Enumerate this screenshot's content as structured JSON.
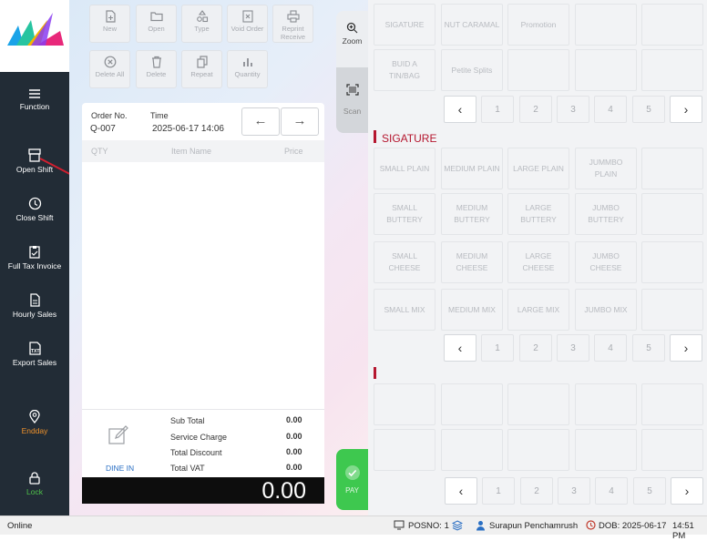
{
  "sidebar": {
    "items": [
      {
        "label": "Function",
        "icon": "menu-icon"
      },
      {
        "label": "Open Shift",
        "icon": "register-icon"
      },
      {
        "label": "Close Shift",
        "icon": "clock-icon"
      },
      {
        "label": "Full Tax Invoice",
        "icon": "clipboard-icon"
      },
      {
        "label": "Hourly Sales",
        "icon": "document-icon"
      },
      {
        "label": "Export Sales",
        "icon": "txt-file-icon"
      },
      {
        "label": "Endday",
        "icon": "location-pin-icon"
      },
      {
        "label": "Lock",
        "icon": "lock-icon"
      }
    ]
  },
  "toolbar": {
    "row1": [
      {
        "label": "New"
      },
      {
        "label": "Open"
      },
      {
        "label": "Type"
      },
      {
        "label": "Void Order"
      },
      {
        "label": "Reprint Receive"
      }
    ],
    "row2": [
      {
        "label": "Delete All"
      },
      {
        "label": "Delete"
      },
      {
        "label": "Repeat"
      },
      {
        "label": "Quantity"
      }
    ]
  },
  "order": {
    "no_label": "Order No.",
    "no": "Q-007",
    "time_label": "Time",
    "time": "2025-06-17 14:06",
    "col_qty": "QTY",
    "col_item": "Item Name",
    "col_price": "Price",
    "order_type": "DINE IN",
    "subtotal_label": "Sub Total",
    "subtotal": "0.00",
    "service_label": "Service Charge",
    "service": "0.00",
    "discount_label": "Total Discount",
    "discount": "0.00",
    "vat_label": "Total VAT",
    "vat": "0.00",
    "grand_total": "0.00"
  },
  "side": {
    "zoom": "Zoom",
    "scan": "Scan",
    "pay": "PAY"
  },
  "categories": [
    [
      "SIGATURE",
      "NUT CARAMAL",
      "Promotion",
      "",
      ""
    ],
    [
      "BUID A TIN/BAG",
      "Petite Splits",
      "",
      "",
      ""
    ]
  ],
  "pager": {
    "prev": "‹",
    "next": "›",
    "pages": [
      "1",
      "2",
      "3",
      "4",
      "5"
    ]
  },
  "section1_title": "SIGATURE",
  "products": [
    [
      "SMALL PLAIN",
      "MEDIUM PLAIN",
      "LARGE PLAIN",
      "JUMMBO PLAIN",
      ""
    ],
    [
      "SMALL BUTTERY",
      "MEDIUM BUTTERY",
      "LARGE BUTTERY",
      "JUMBO BUTTERY",
      ""
    ],
    [
      "SMALL CHEESE",
      "MEDIUM CHEESE",
      "LARGE CHEESE",
      "JUMBO CHEESE",
      ""
    ],
    [
      "SMALL MIX",
      "MEDIUM MIX",
      "LARGE MIX",
      "JUMBO MIX",
      ""
    ]
  ],
  "annotation": "1",
  "status": {
    "online": "Online",
    "posno": "POSNO: 1",
    "user": "Surapun Penchamrush",
    "dob": "DOB: 2025-06-17",
    "time": "14:51 PM"
  },
  "colors": {
    "sidebar": "#222c36",
    "accent": "#b5172f",
    "pay": "#3ec84f",
    "callout": "#d01f2f"
  }
}
